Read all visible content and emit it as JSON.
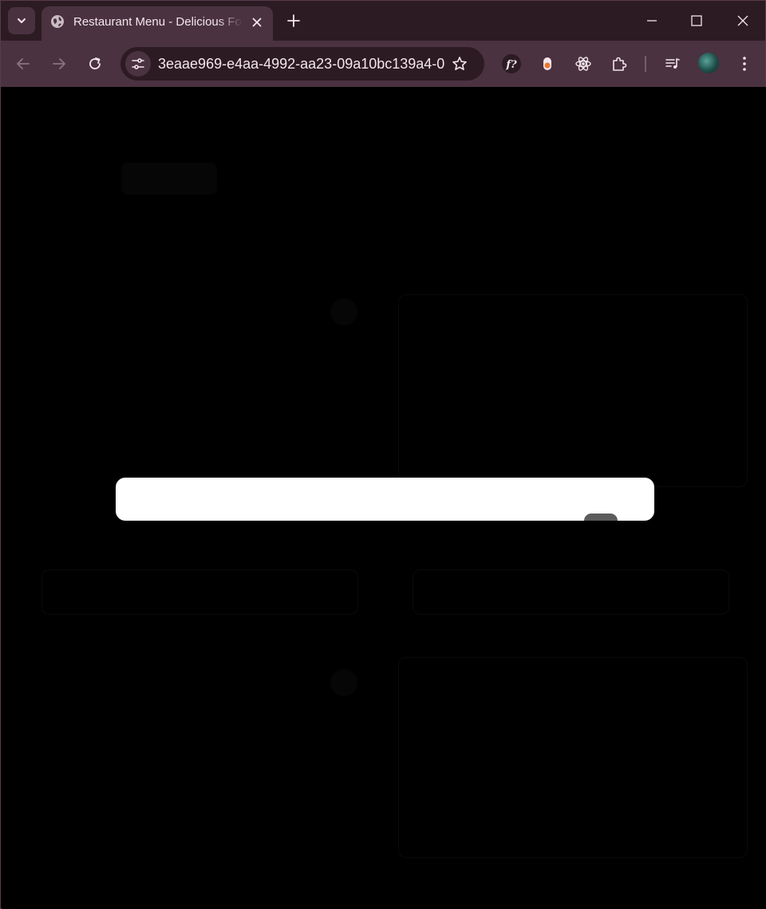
{
  "window": {
    "tab_title": "Restaurant Menu - Delicious Food",
    "url": "3eaae969-e4aa-4992-aa23-09a10bc139a4-0...",
    "extensions": [
      {
        "name": "f? extension",
        "label": "f?"
      },
      {
        "name": "record extension",
        "label": ""
      },
      {
        "name": "react devtools",
        "label": ""
      },
      {
        "name": "extensions puzzle",
        "label": ""
      }
    ]
  },
  "dialog": {
    "text": ""
  },
  "colors": {
    "tabstrip": "#2c1b22",
    "toolbar": "#4b3240",
    "page_background": "#000000",
    "dialog_background": "#ffffff"
  }
}
